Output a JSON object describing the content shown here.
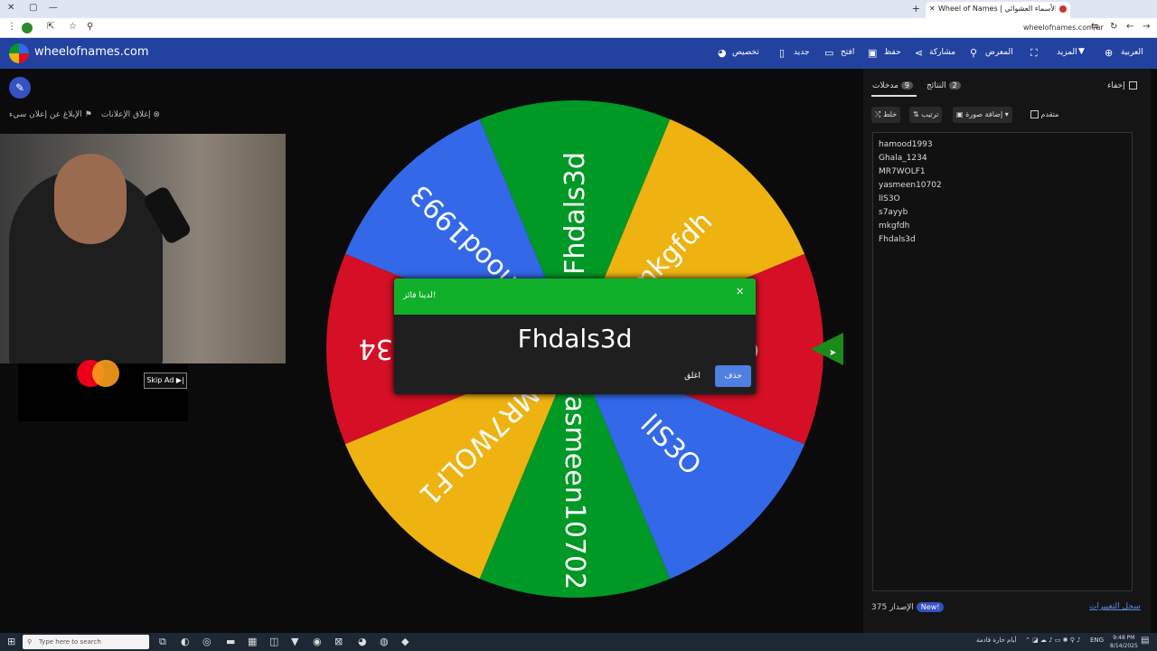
{
  "browser": {
    "tab_title": "Wheel of Names | عجلة الأسماء العشوائي",
    "url": "wheelofnames.com/ar",
    "window_buttons": [
      "✕",
      "▢",
      "—"
    ]
  },
  "site": {
    "brand": "wheelofnames.com",
    "nav": {
      "customize": "تخصيص",
      "new": "جديد",
      "open": "افتح",
      "save": "حفظ",
      "share": "مشاركة",
      "gallery": "المعرض",
      "more": "المزيد",
      "language": "العربية"
    }
  },
  "left": {
    "report_ad": "الإبلاغ عن إعلان سيء",
    "close_ads": "إغلاق الإعلانات",
    "skip_ad": "Skip Ad ▶|"
  },
  "wheel": {
    "segments": [
      {
        "label": "hamood1993",
        "color": "#3369e8"
      },
      {
        "label": "Ghala_1234",
        "color": "#d50f25"
      },
      {
        "label": "MR7WOLF1",
        "color": "#eeb211"
      },
      {
        "label": "yasmeen10702",
        "color": "#009925"
      },
      {
        "label": "lIS3O",
        "color": "#3369e8"
      },
      {
        "label": "s7ayyb",
        "color": "#d50f25"
      },
      {
        "label": "mkgfdh",
        "color": "#eeb211"
      },
      {
        "label": "Fhdals3d",
        "color": "#009925"
      }
    ]
  },
  "dialog": {
    "title": "لدينا فائز!",
    "winner": "Fhdals3d",
    "remove_label": "حذف",
    "close_label": "اغلق"
  },
  "panel": {
    "tab_entries": "مدخلات",
    "tab_entries_count": "9",
    "tab_results": "النتائج",
    "tab_results_count": "2",
    "hide": "إخفاء",
    "shuffle": "خلط",
    "sort": "ترتيب",
    "add_image": "إضافة صورة",
    "advanced": "متقدم",
    "entries": [
      "hamood1993",
      "Ghala_1234",
      "MR7WOLF1",
      "yasmeen10702",
      "lIS3O",
      "s7ayyb",
      "mkgfdh",
      "Fhdals3d"
    ],
    "version_label": "الإصدار",
    "version": "375",
    "new_badge": "New!",
    "changelog": "سجل التغييرات"
  },
  "taskbar": {
    "search_placeholder": "Type here to search",
    "weather": "أيام حارة قادمة",
    "lang": "ENG",
    "time": "9:48 PM",
    "date": "8/14/2025"
  }
}
